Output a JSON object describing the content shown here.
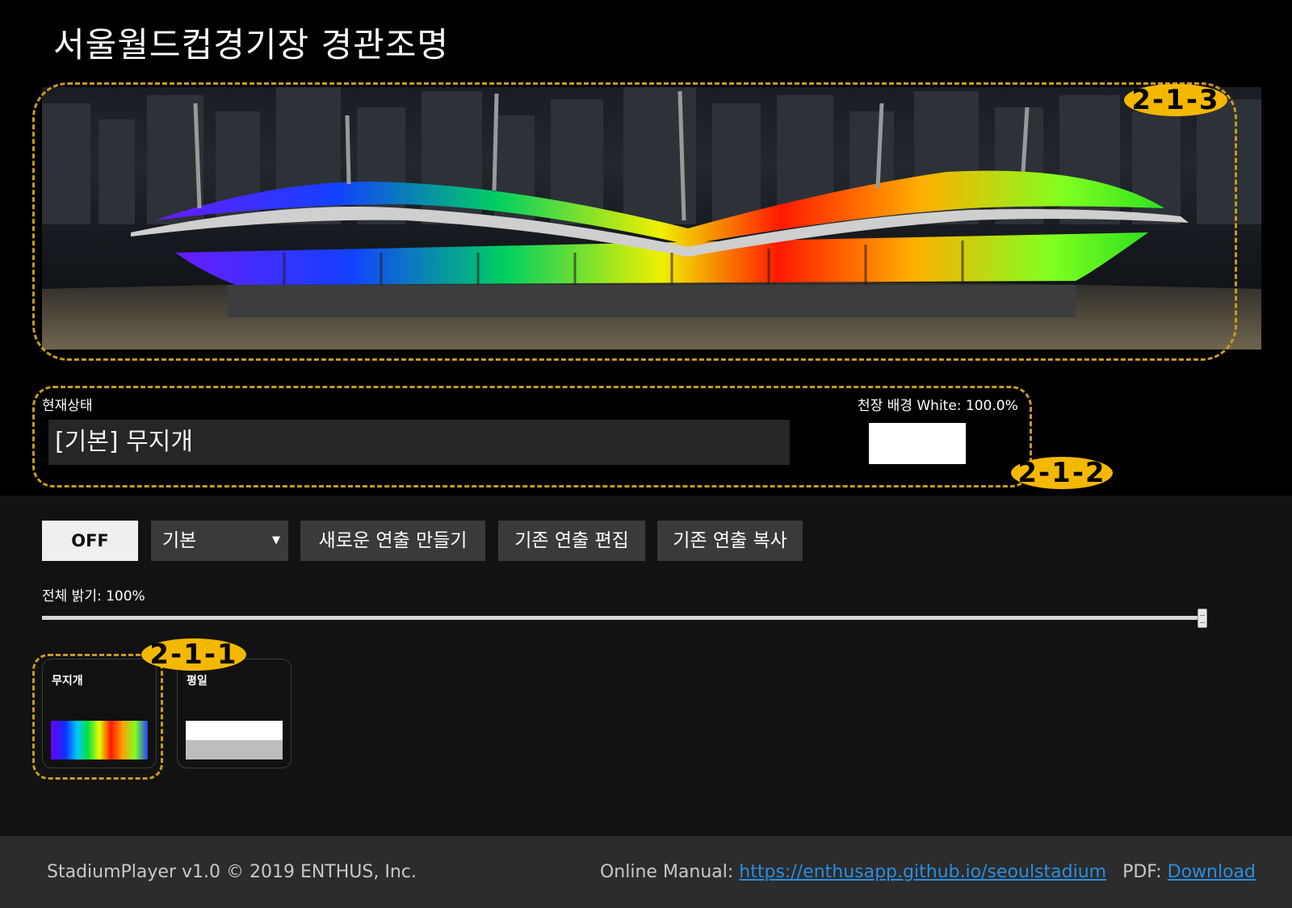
{
  "page": {
    "title": "서울월드컵경기장 경관조명"
  },
  "preview": {
    "image_desc": "stadium-rainbow-preview"
  },
  "annotations": {
    "preview": "2-1-3",
    "status": "2-1-2",
    "scene": "2-1-1"
  },
  "status": {
    "label": "현재상태",
    "current_scene": "[기본] 무지개",
    "ceiling_label": "천장 배경 White: 100.0%",
    "ceiling_color": "#ffffff"
  },
  "controls": {
    "off_label": "OFF",
    "category_selected": "기본",
    "new_label": "새로운 연출 만들기",
    "edit_label": "기존 연출 편집",
    "copy_label": "기존 연출 복사"
  },
  "brightness": {
    "label": "전체 밝기: 100%",
    "value": 1.0
  },
  "scenes": [
    {
      "label": "무지개",
      "swatch": "rainbow"
    },
    {
      "label": "평일",
      "swatch": "white-gray"
    }
  ],
  "footer": {
    "copyright": "StadiumPlayer v1.0 © 2019 ENTHUS, Inc.",
    "manual_prefix": "Online Manual: ",
    "manual_link": "https://enthusapp.github.io/seoulstadium",
    "pdf_prefix": "PDF: ",
    "pdf_link": "Download"
  }
}
